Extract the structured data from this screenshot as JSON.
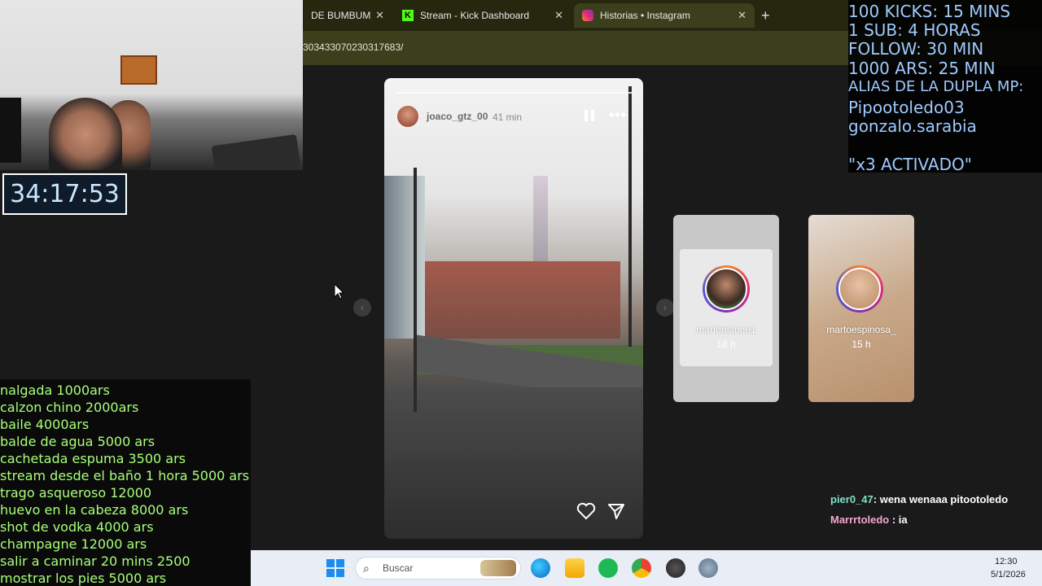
{
  "browser": {
    "tabs": [
      {
        "label": "DE BUMBUM",
        "active": false
      },
      {
        "label": "Stream - Kick Dashboard",
        "active": false
      },
      {
        "label": "Historias • Instagram",
        "active": true
      }
    ],
    "new_tab": "+",
    "close_glyph": "✕",
    "url": "303433070230317683/"
  },
  "story": {
    "username": "joaco_gtz_00",
    "time": "41 min",
    "more": "•••"
  },
  "previews": [
    {
      "username": "martonstone1",
      "time": "18 h"
    },
    {
      "username": "martoespinosa_",
      "time": "15 h"
    }
  ],
  "nav": {
    "prev": "‹",
    "next": "›"
  },
  "timer": "34:17:53",
  "overlay_rules": [
    "100 KICKS: 15 MINS",
    "1 SUB: 4 HORAS",
    "FOLLOW: 30 MIN",
    "1000 ARS: 25 MIN",
    "ALIAS DE LA DUPLA MP:",
    "Pipootoledo03",
    "gonzalo.sarabia",
    "\"x3 ACTIVADO\""
  ],
  "price_list": [
    "nalgada 1000ars",
    "calzon chino 2000ars",
    "baile 4000ars",
    "balde de agua 5000 ars",
    "cachetada espuma 3500 ars",
    "stream desde el baño 1 hora 5000 ars",
    "trago asqueroso 12000",
    "huevo en la cabeza 8000 ars",
    "shot de vodka 4000 ars",
    "champagne 12000 ars",
    "salir a caminar 20 mins 2500",
    "mostrar los pies 5000 ars"
  ],
  "chat": [
    {
      "user": "pier0_47",
      "message": ": wena wenaaa pitootoledo",
      "color": "#7fe0c8"
    },
    {
      "user": "Marrrtoledo",
      "message": " : ia",
      "color": "#f2a8cf"
    }
  ],
  "taskbar": {
    "search_placeholder": "Buscar",
    "search_glyph": "⌕",
    "time": "12:30",
    "date": "5/1/2026"
  },
  "colors": {
    "browser_bg": "#3c3f1c",
    "rules_text": "#9fcaff",
    "price_text": "#a8ff7a",
    "timer_text": "#c9e6ff"
  },
  "icons": [
    "kick-icon",
    "instagram-icon",
    "pause-icon",
    "more-icon",
    "heart-icon",
    "send-icon",
    "windows-start-icon",
    "search-icon",
    "edge-icon",
    "file-explorer-icon",
    "spotify-icon",
    "chrome-icon",
    "obs-icon",
    "settings-icon"
  ]
}
